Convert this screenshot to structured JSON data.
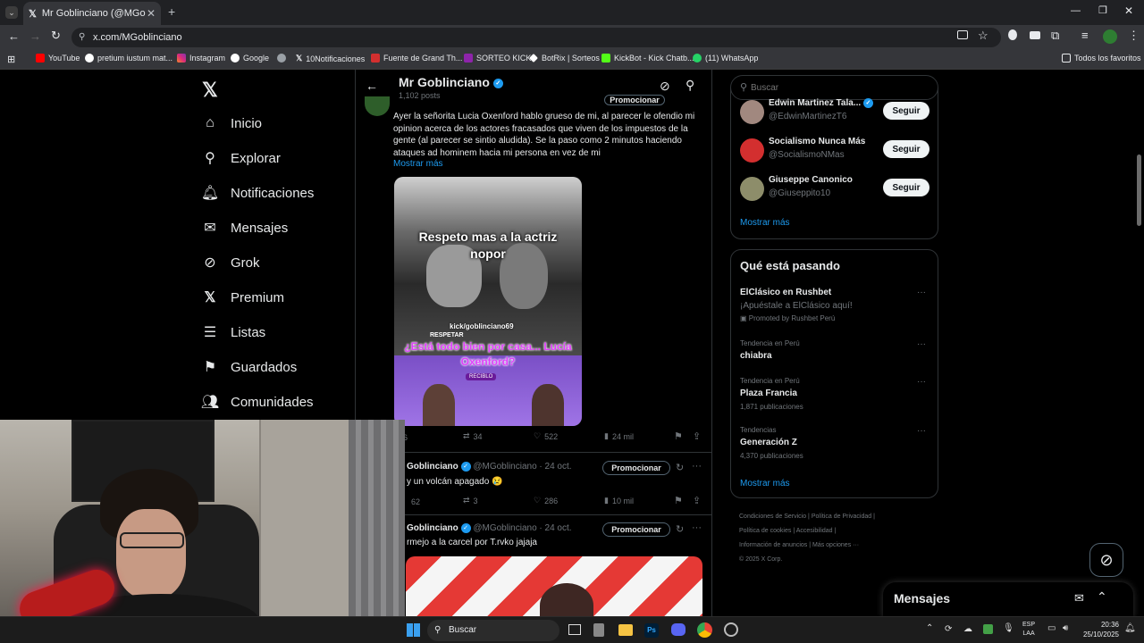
{
  "browser": {
    "tab_title": "Mr Goblinciano (@MGoblinciano",
    "url": "x.com/MGoblinciano",
    "bookmarks": [
      "YouTube",
      "pretium iustum mat...",
      "Instagram",
      "Google",
      "",
      "10Notificaciones",
      "Fuente de Grand Th...",
      "SORTEO KICK",
      "BotRix | Sorteos",
      "KickBot - Kick Chatb...",
      "(11) WhatsApp"
    ],
    "bookmarks_right": "Todos los favoritos"
  },
  "nav": {
    "items": [
      "Inicio",
      "Explorar",
      "Notificaciones",
      "Mensajes",
      "Grok",
      "Premium",
      "Listas",
      "Guardados",
      "Comunidades"
    ]
  },
  "profile_header": {
    "name": "Mr Goblinciano",
    "posts": "1,102 posts"
  },
  "post1": {
    "promote_label": "Promocionar",
    "text": "Ayer la señorita Lucia Oxenford hablo grueso de mi, al parecer le ofendio mi opinion acerca de los actores fracasados que viven de los impuestos de la gente (al parecer se sintio aludida). Se la paso como 2 minutos haciendo ataques ad hominem hacia mi persona en vez de mi",
    "show_more": "Mostrar más",
    "media_top": "Respeto mas a la actriz nopor",
    "media_handle": "kick/goblinciano69",
    "media_respetar": "RESPETAR",
    "media_bottom": "¿Está todo bien por casa... Lucía Oxenford?",
    "media_badge": "RECIBLO",
    "replies": "96",
    "reposts": "34",
    "likes": "522",
    "views": "24 mil"
  },
  "post2": {
    "name": "Goblinciano",
    "handle": "@MGoblinciano",
    "date": "· 24 oct.",
    "promote_label": "Promocionar",
    "text": "y un volcán apagado 😢",
    "replies": "62",
    "reposts": "3",
    "likes": "286",
    "views": "10 mil"
  },
  "post3": {
    "name": "Goblinciano",
    "handle": "@MGoblinciano",
    "date": "· 24 oct.",
    "promote_label": "Promocionar",
    "text": "rmejo a la carcel por T.rvko jajaja"
  },
  "search": {
    "placeholder": "Buscar"
  },
  "follow": {
    "items": [
      {
        "name": "Edwin Martinez Tala...",
        "handle": "@EdwinMartinezT6",
        "button": "Seguir"
      },
      {
        "name": "Socialismo Nunca Más",
        "handle": "@SocialismoNMas",
        "button": "Seguir"
      },
      {
        "name": "Giuseppe Canonico",
        "handle": "@Giuseppito10",
        "button": "Seguir"
      }
    ],
    "show_more": "Mostrar más"
  },
  "trends": {
    "title": "Qué está pasando",
    "items": [
      {
        "context": "",
        "name": "ElClásico en Rushbet",
        "sub": "¡Apuéstale a ElClásico aquí!",
        "meta": "Promoted by Rushbet Perú"
      },
      {
        "context": "Tendencia en Perú",
        "name": "chiabra",
        "sub": "",
        "meta": ""
      },
      {
        "context": "Tendencia en Perú",
        "name": "Plaza Francia",
        "sub": "",
        "meta": "1,871 publicaciones"
      },
      {
        "context": "Tendencias",
        "name": "Generación Z",
        "sub": "",
        "meta": "4,370 publicaciones"
      }
    ],
    "show_more": "Mostrar más"
  },
  "footer": {
    "links": [
      "Condiciones de Servicio",
      "Política de Privacidad",
      "Política de cookies",
      "Accesibilidad",
      "Información de anuncios",
      "Más opciones ···"
    ],
    "copyright": "© 2025 X Corp."
  },
  "messages_drawer": {
    "title": "Mensajes"
  },
  "taskbar": {
    "search_placeholder": "Buscar",
    "lang_1": "ESP",
    "lang_2": "LAA",
    "time": "20:36",
    "date": "25/10/2025"
  }
}
